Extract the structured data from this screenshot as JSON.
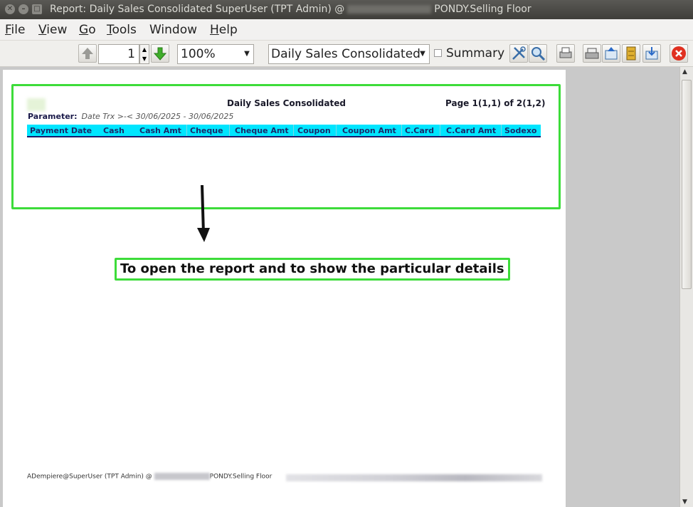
{
  "window": {
    "title_prefix": "Report: Daily Sales Consolidated  SuperUser (TPT Admin) @",
    "title_suffix": "PONDY.Selling Floor",
    "close_glyph": "✕",
    "minimize_glyph": "–",
    "maximize_glyph": "□"
  },
  "menu": {
    "items": [
      {
        "label": "File",
        "mnemonic": "F",
        "rest": "ile"
      },
      {
        "label": "View",
        "mnemonic": "V",
        "rest": "iew"
      },
      {
        "label": "Go",
        "mnemonic": "G",
        "rest": "o"
      },
      {
        "label": "Tools",
        "mnemonic": "T",
        "rest": "ools"
      },
      {
        "label": "Window",
        "mnemonic": "",
        "rest": "Window"
      },
      {
        "label": "Help",
        "mnemonic": "H",
        "rest": "elp"
      }
    ]
  },
  "toolbar": {
    "page_number": "1",
    "zoom": "100%",
    "report_name": "Daily Sales Consolidated",
    "summary_label": "Summary",
    "summary_checked": false
  },
  "report": {
    "title": "Daily Sales Consolidated",
    "page_info": "Page 1(1,1) of 2(1,2)",
    "parameter_label": "Parameter:",
    "parameter_value": "Date Trx  >-<  30/06/2025 - 30/06/2025",
    "columns": [
      "Payment Date",
      "Cash",
      "Cash Amt",
      "Cheque",
      "Cheque Amt",
      "Coupon",
      "Coupon Amt",
      "C.Card",
      "C.Card Amt",
      "Sodexo"
    ],
    "footer_prefix": "ADempiere@SuperUser (TPT Admin) @",
    "footer_suffix": "PONDY.Selling Floor"
  },
  "annotation": {
    "text": "To open the report and to show the particular details",
    "color": "#3ddc3a"
  },
  "colors": {
    "header_band": "#00e5ff",
    "highlight": "#3ddc3a",
    "close_button": "#e03020"
  }
}
